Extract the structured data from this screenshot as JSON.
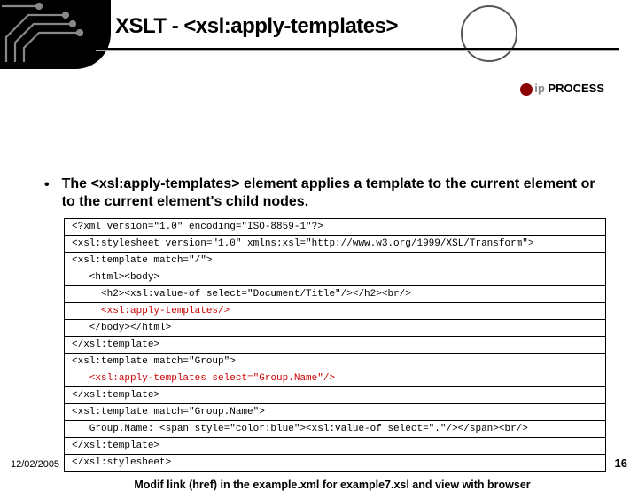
{
  "title": "XSLT - <xsl:apply-templates>",
  "logo": {
    "prefix": "ip",
    "suffix": "PROCESS"
  },
  "bullet": "The <xsl:apply-templates> element applies a template to the current element or to the current element's child nodes.",
  "code": {
    "l1": "<?xml version=\"1.0\" encoding=\"ISO-8859-1\"?>",
    "l2": "<xsl:stylesheet version=\"1.0\" xmlns:xsl=\"http://www.w3.org/1999/XSL/Transform\">",
    "l3": "<xsl:template match=\"/\">",
    "l4": "   <html><body>",
    "l5": "     <h2><xsl:value-of select=\"Document/Title\"/></h2><br/>",
    "l6_pre": "     ",
    "l6_red": "<xsl:apply-templates/>",
    "l7": "   </body></html>",
    "l8": "</xsl:template>",
    "l9": "<xsl:template match=\"Group\">",
    "l10_pre": "   ",
    "l10_red": "<xsl:apply-templates select=\"Group.Name\"/>",
    "l11": "</xsl:template>",
    "l12": "<xsl:template match=\"Group.Name\">",
    "l13": "   Group.Name: <span style=\"color:blue\"><xsl:value-of select=\".\"/></span><br/>",
    "l14": "</xsl:template>",
    "l15": "</xsl:stylesheet>"
  },
  "note": "Modif link (href) in the example.xml for example7.xsl and view with browser",
  "date": "12/02/2005",
  "page": "16"
}
